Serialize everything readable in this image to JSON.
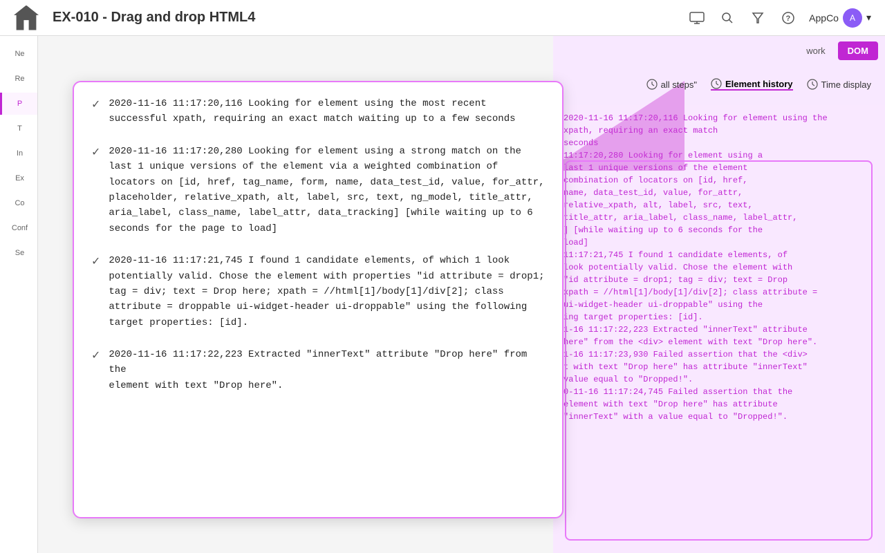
{
  "header": {
    "title": "EX-010 - Drag and drop HTML4",
    "user_label": "AppCo",
    "home_icon": "home",
    "monitor_icon": "⬛",
    "search_icon": "🔍",
    "filter_icon": "⚗",
    "help_icon": "❓"
  },
  "sidebar": {
    "items": [
      {
        "label": "Ne",
        "active": false
      },
      {
        "label": "Re",
        "active": false
      },
      {
        "label": "P",
        "active": true
      },
      {
        "label": "T",
        "active": false
      },
      {
        "label": "In",
        "active": false
      },
      {
        "label": "Ex",
        "active": false
      },
      {
        "label": "Co",
        "active": false
      },
      {
        "label": "Conf",
        "active": false
      },
      {
        "label": "Se",
        "active": false
      }
    ]
  },
  "tabs": [
    {
      "label": "work",
      "active": false
    },
    {
      "label": "DOM",
      "active": true
    }
  ],
  "panel_controls": [
    {
      "label": "all steps\"",
      "icon": "clock",
      "active": false
    },
    {
      "label": "Element history",
      "icon": "clock",
      "active": true
    },
    {
      "label": "Time display",
      "icon": "clock",
      "active": false
    }
  ],
  "log_entries": [
    {
      "id": 1,
      "text": "2020-11-16 11:17:20,116 Looking for element using the most recent successful xpath, requiring an exact match waiting up to a few seconds"
    },
    {
      "id": 2,
      "text": "2020-11-16 11:17:20,280 Looking for element using a strong match on the last 1 unique versions of the element via a weighted combination of locators on [id, href, tag_name, form, name, data_test_id, value, for_attr, placeholder, relative_xpath, alt, label, src, text, ng_model, title_attr, aria_label, class_name, label_attr, data_tracking] [while waiting up to 6 seconds for the page to load]"
    },
    {
      "id": 3,
      "text": "2020-11-16 11:17:21,745 I found 1 candidate elements, of which 1 look potentially valid. Chose the element with properties \"id attribute = drop1; tag = div; text = Drop here; xpath = //html[1]/body[1]/div[2]; class attribute = droppable ui-widget-header ui-droppable\" using the following target properties: [id]."
    },
    {
      "id": 4,
      "text": "2020-11-16 11:17:22,223 Extracted \"innerText\" attribute \"Drop here\" from the <div> element with text \"Drop here\"."
    }
  ],
  "bg_log_lines": [
    "2020-11-16 11:17:20,116 Looking for element using the",
    "xpath, requiring an exact match",
    "seconds",
    "",
    "11:17:20,280 Looking for element using a",
    "last 1 unique versions of the element",
    "combination of locators on [id, href,",
    "name, data_test_id, value, for_attr,",
    "relative_xpath, alt, label, src, text,",
    "title_attr, aria_label, class_name, label_attr,",
    "] [while waiting up to 6 seconds for the",
    "load]",
    "",
    "11:17:21,745 I found 1 candidate elements, of",
    "look potentially valid. Chose the element with",
    "\"id attribute = drop1; tag = div; text = Drop",
    "xpath = //html[1]/body[1]/div[2]; class attribute =",
    "ui-widget-header ui-droppable\" using the",
    "ing target properties: [id].",
    "",
    "1-16 11:17:22,223 Extracted \"innerText\" attribute",
    "here\" from the <div> element with text \"Drop here\".",
    "",
    "1-16 11:17:23,930 Failed assertion that the <div>",
    "t with text \"Drop here\" has attribute \"innerText\"",
    "value equal to \"Dropped!\".",
    "",
    "0-11-16 11:17:24,745 Failed assertion that the",
    "element with text \"Drop here\" has attribute",
    "\"innerText\" with a value equal to \"Dropped!\"."
  ]
}
